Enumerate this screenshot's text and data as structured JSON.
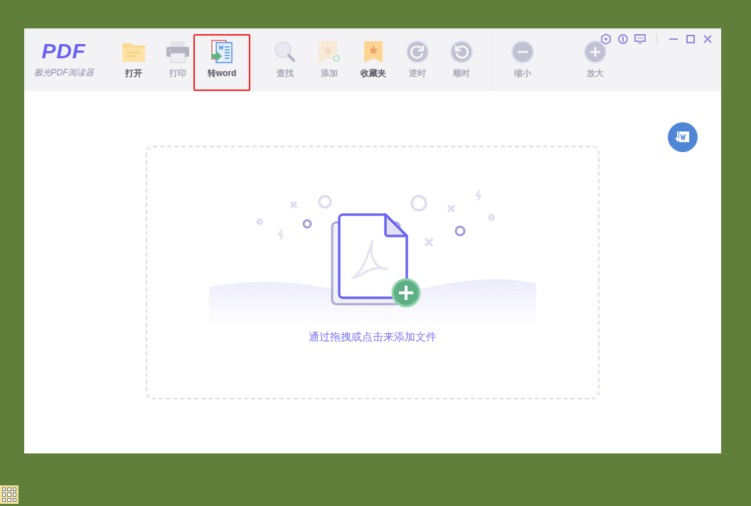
{
  "window": {
    "logo": {
      "mark": "PDF",
      "name": "极光PDF阅读器"
    }
  },
  "toolbar": {
    "groups": [
      [
        {
          "label": "打开",
          "kind": "open",
          "disabled": false,
          "highlighted": false
        },
        {
          "label": "打印",
          "kind": "print",
          "disabled": true,
          "highlighted": false
        },
        {
          "label": "转word",
          "kind": "to-word",
          "disabled": false,
          "highlighted": true
        }
      ],
      [
        {
          "label": "查找",
          "kind": "search",
          "disabled": true,
          "highlighted": false
        },
        {
          "label": "添加",
          "kind": "add-bookmark",
          "disabled": true,
          "highlighted": false
        },
        {
          "label": "收藏夹",
          "kind": "bookmarks",
          "disabled": false,
          "highlighted": false
        },
        {
          "label": "逆时",
          "kind": "rotate-left",
          "disabled": true,
          "highlighted": false
        },
        {
          "label": "顺时",
          "kind": "rotate-right",
          "disabled": true,
          "highlighted": false
        }
      ],
      [
        {
          "label": "缩小",
          "kind": "zoom-out",
          "disabled": true,
          "highlighted": false
        },
        {
          "label": "放大",
          "kind": "zoom-in",
          "disabled": true,
          "highlighted": false
        }
      ]
    ]
  },
  "drop_zone": {
    "hint": "通过拖拽或点击来添加文件"
  }
}
